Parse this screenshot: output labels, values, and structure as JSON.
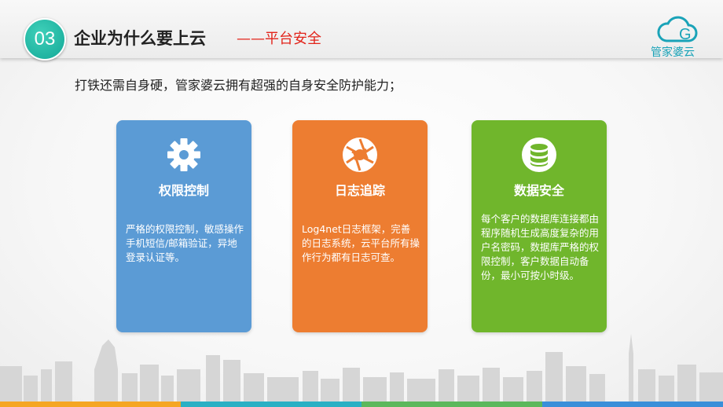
{
  "header": {
    "badge_number": "03",
    "title": "企业为什么要上云",
    "subtitle": "——平台安全"
  },
  "logo": {
    "text": "管家婆云",
    "letter": "G"
  },
  "intro": "打铁还需自身硬，管家婆云拥有超强的自身安全防护能力；",
  "cards": [
    {
      "icon": "gear-icon",
      "title": "权限控制",
      "description": "严格的权限控制，敏感操作手机短信/邮箱验证，异地登录认证等。",
      "color": "#5b9bd5"
    },
    {
      "icon": "aperture-icon",
      "title": "日志追踪",
      "description": "Log4net日志框架，完善的日志系统，云平台所有操作行为都有日志可查。",
      "color": "#ed7d31"
    },
    {
      "icon": "database-icon",
      "title": "数据安全",
      "description": "每个客户的数据库连接都由程序随机生成高度复杂的用户名密码，数据库严格的权限控制，客户数据自动备份，最小可按小时级。",
      "color": "#70b62c"
    }
  ],
  "colors": {
    "teal": "#17b09e",
    "accent_red": "#e2231a",
    "bar": [
      "#f5a623",
      "#2ab0c4",
      "#5cb85c",
      "#3a8fd9"
    ]
  }
}
